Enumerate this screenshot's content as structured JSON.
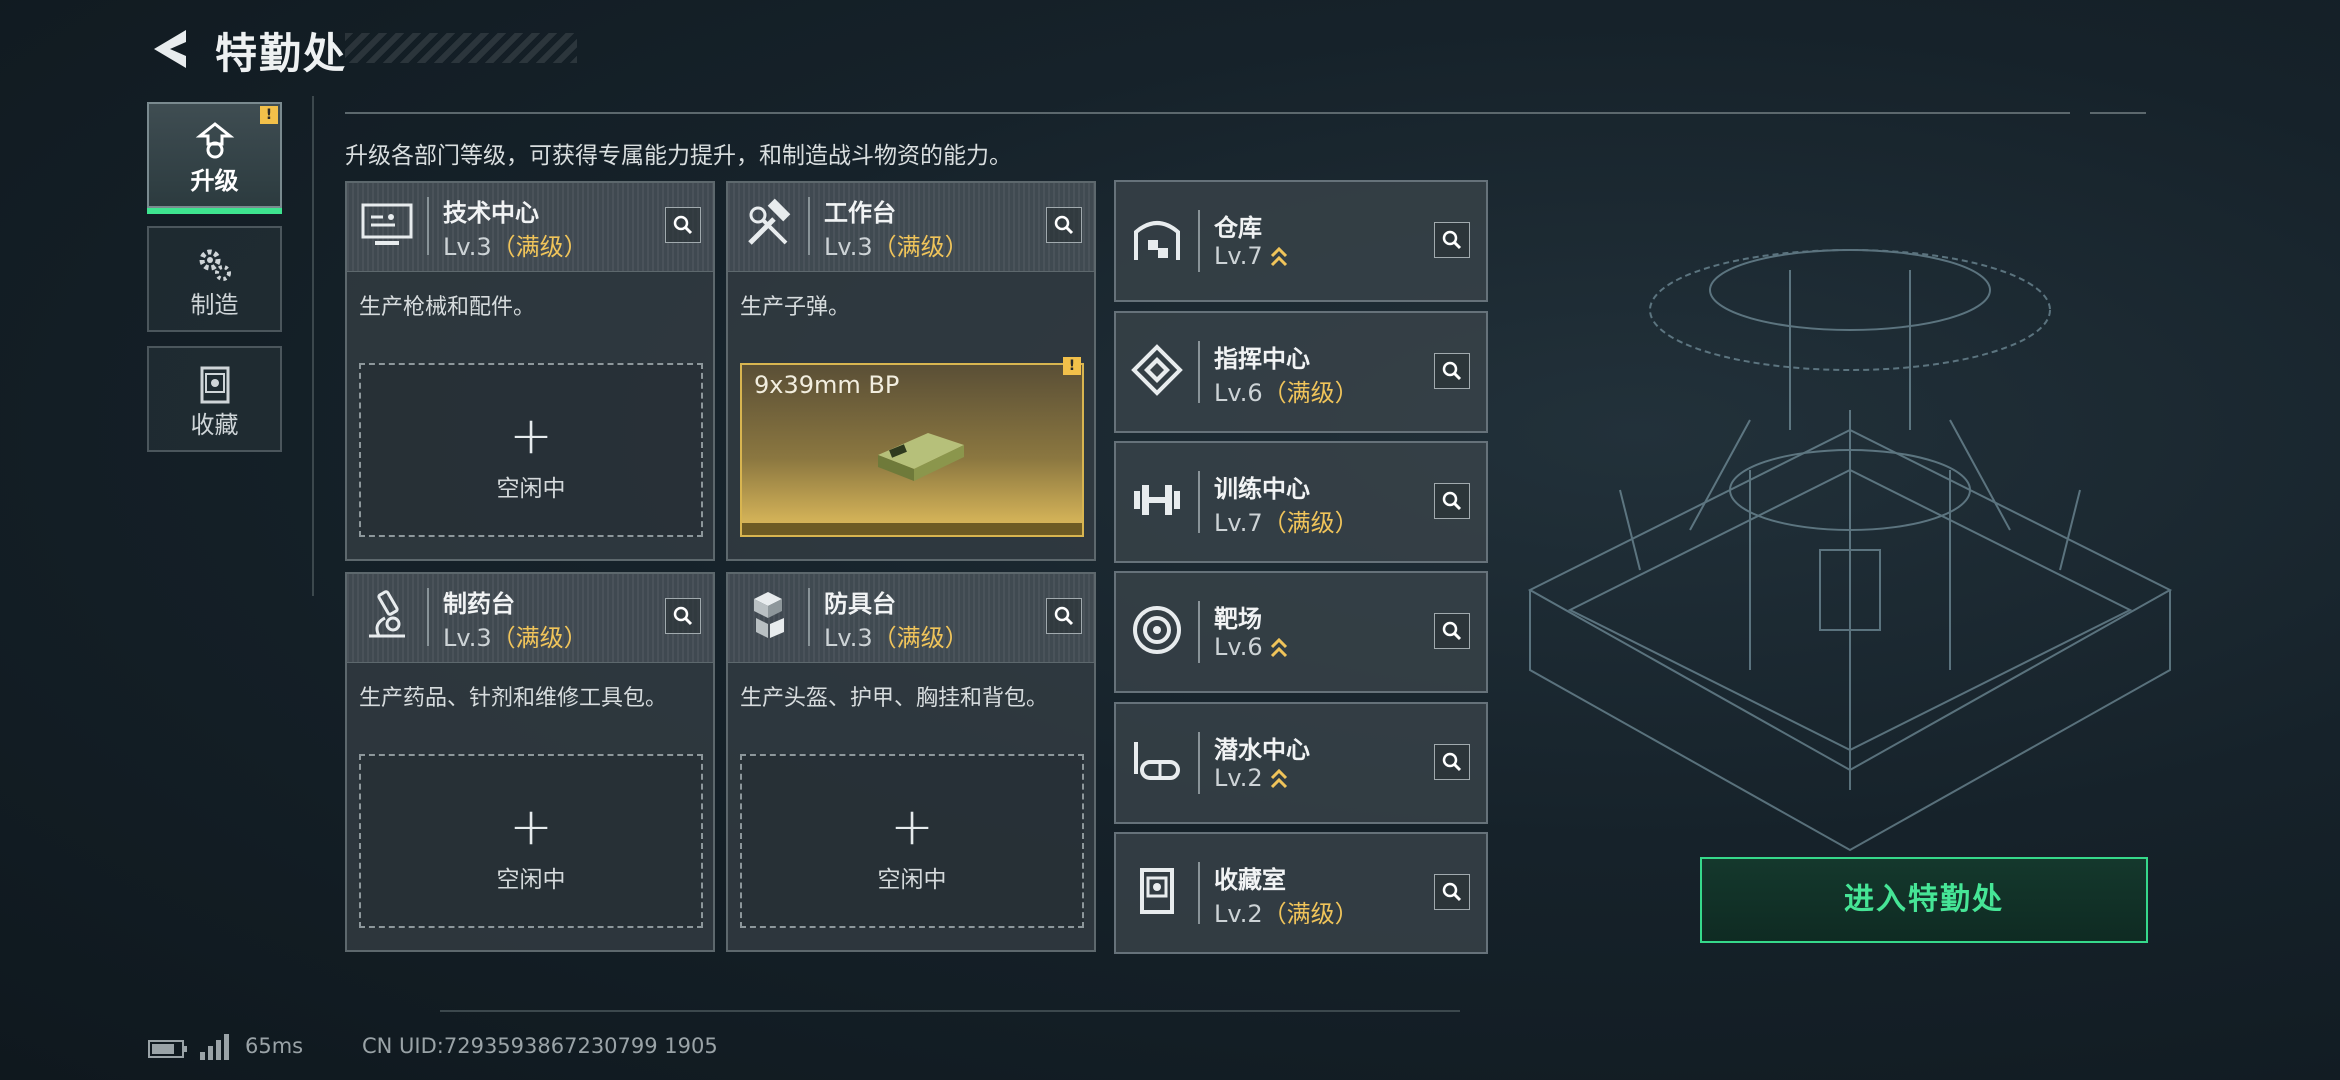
{
  "header": {
    "title": "特勤处"
  },
  "tabs": [
    {
      "label": "升级",
      "badge": "!",
      "active": true
    },
    {
      "label": "制造"
    },
    {
      "label": "收藏"
    }
  ],
  "subtitle": "升级各部门等级，可获得专属能力提升，和制造战斗物资的能力。",
  "departments": [
    {
      "name": "技术中心",
      "level": "Lv.3",
      "status": "（满级）",
      "desc": "生产枪械和配件。",
      "slot_plus": "+",
      "slot_label": "空闲中"
    },
    {
      "name": "工作台",
      "level": "Lv.3",
      "status": "（满级）",
      "desc": "生产子弹。",
      "product": "9x39mm BP",
      "badge": "!"
    },
    {
      "name": "制药台",
      "level": "Lv.3",
      "status": "（满级）",
      "desc": "生产药品、针剂和维修工具包。",
      "slot_plus": "+",
      "slot_label": "空闲中"
    },
    {
      "name": "防具台",
      "level": "Lv.3",
      "status": "（满级）",
      "desc": "生产头盔、护甲、胸挂和背包。",
      "slot_plus": "+",
      "slot_label": "空闲中"
    }
  ],
  "facilities": [
    {
      "name": "仓库",
      "level": "Lv.7",
      "status": "",
      "upgradable": true,
      "icon": "warehouse-icon"
    },
    {
      "name": "指挥中心",
      "level": "Lv.6",
      "status": "（满级）",
      "upgradable": false,
      "icon": "command-icon"
    },
    {
      "name": "训练中心",
      "level": "Lv.7",
      "status": "（满级）",
      "upgradable": false,
      "icon": "dumbbell-icon"
    },
    {
      "name": "靶场",
      "level": "Lv.6",
      "status": "",
      "upgradable": true,
      "icon": "target-icon"
    },
    {
      "name": "潜水中心",
      "level": "Lv.2",
      "status": "",
      "upgradable": true,
      "icon": "diving-mask-icon"
    },
    {
      "name": "收藏室",
      "level": "Lv.2",
      "status": "（满级）",
      "upgradable": false,
      "icon": "collection-icon"
    }
  ],
  "enter_button": "进入特勤处",
  "status_bar": {
    "ping": "65ms",
    "uid": "CN UID:7293593867230799 1905"
  },
  "colors": {
    "accent_green": "#3ee38f",
    "gold": "#f0c45a",
    "warning": "#f2c04a"
  }
}
